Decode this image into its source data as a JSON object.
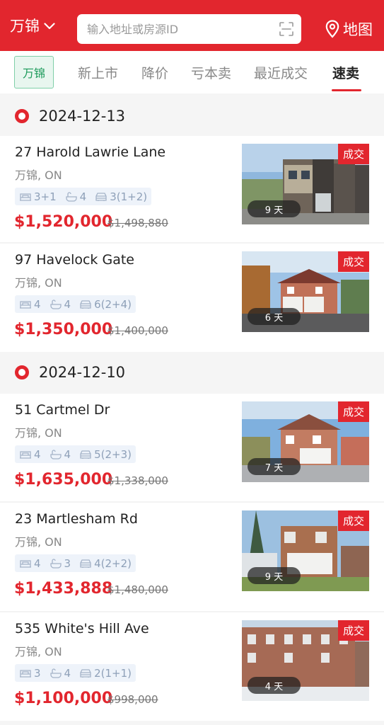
{
  "header": {
    "city": "万锦",
    "search_placeholder": "输入地址或房源ID",
    "map_label": "地图"
  },
  "filters": {
    "city_tag": "万锦",
    "tabs": [
      "新上市",
      "降价",
      "亏本卖",
      "最近成交",
      "速卖"
    ],
    "active_tab": "速卖"
  },
  "groups": [
    {
      "date": "2024-12-13",
      "listings": [
        {
          "address": "27 Harold Lawrie Lane",
          "city": "万锦, ON",
          "beds": "3+1",
          "baths": "4",
          "parking": "3(1+2)",
          "price": "$1,520,000",
          "original_price": "$1,498,880",
          "status": "成交",
          "days": "9 天"
        },
        {
          "address": "97 Havelock Gate",
          "city": "万锦, ON",
          "beds": "4",
          "baths": "4",
          "parking": "6(2+4)",
          "price": "$1,350,000",
          "original_price": "$1,400,000",
          "status": "成交",
          "days": "6 天"
        }
      ]
    },
    {
      "date": "2024-12-10",
      "listings": [
        {
          "address": "51 Cartmel Dr",
          "city": "万锦, ON",
          "beds": "4",
          "baths": "4",
          "parking": "5(2+3)",
          "price": "$1,635,000",
          "original_price": "$1,338,000",
          "status": "成交",
          "days": "7 天"
        },
        {
          "address": "23 Martlesham Rd",
          "city": "万锦, ON",
          "beds": "4",
          "baths": "3",
          "parking": "4(2+2)",
          "price": "$1,433,888",
          "original_price": "$1,480,000",
          "status": "成交",
          "days": "9 天"
        },
        {
          "address": "535 White's Hill Ave",
          "city": "万锦, ON",
          "beds": "3",
          "baths": "4",
          "parking": "2(1+1)",
          "price": "$1,100,000",
          "original_price": "$998,000",
          "status": "成交",
          "days": "4 天"
        }
      ]
    }
  ],
  "colors": {
    "brand": "#e2262e",
    "city_tag_bg": "#e8f6ef",
    "city_tag_text": "#1b9a5a"
  },
  "icons": [
    "chevron-down-icon",
    "scan-icon",
    "map-pin-icon",
    "bed-icon",
    "bath-icon",
    "car-icon"
  ]
}
